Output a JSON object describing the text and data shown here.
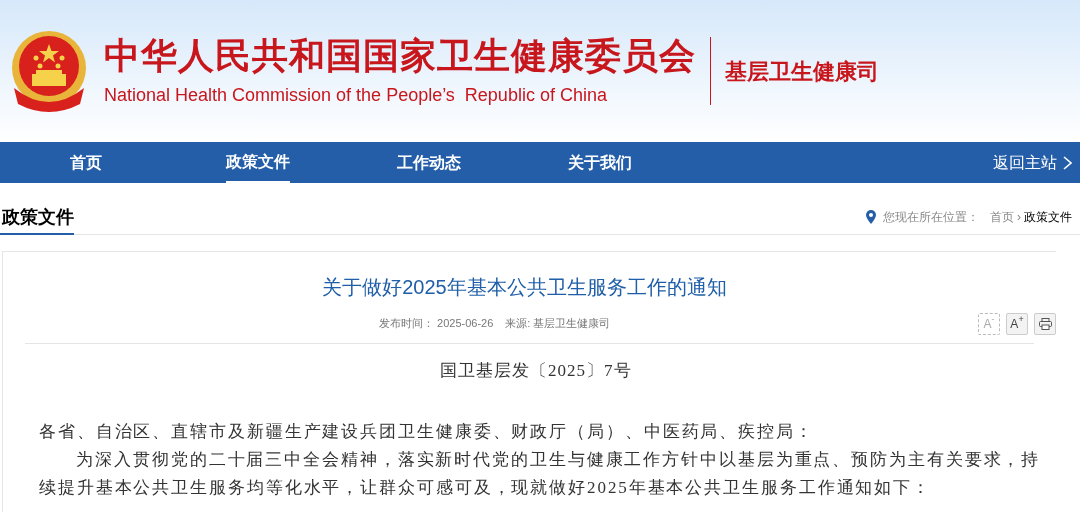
{
  "header": {
    "title": "中华人民共和国国家卫生健康委员会",
    "subtitle": "National Health Commission of the People’s  Republic of China",
    "department": "基层卫生健康司"
  },
  "nav": {
    "items": [
      {
        "label": "首页",
        "selected": false
      },
      {
        "label": "政策文件",
        "selected": true
      },
      {
        "label": "工作动态",
        "selected": false
      },
      {
        "label": "关于我们",
        "selected": false
      }
    ],
    "back_link": "返回主站"
  },
  "section": {
    "title": "政策文件",
    "location_label": "您现在所在位置：",
    "separator": "›",
    "breadcrumb": [
      {
        "label": "首页",
        "current": false
      },
      {
        "label": "政策文件",
        "current": true
      }
    ]
  },
  "article": {
    "title": "关于做好2025年基本公共卫生服务工作的通知",
    "published": "发布时间： 2025-06-26",
    "source": "来源: 基层卫生健康司",
    "tools": [
      {
        "label": "A$^{-}$",
        "kind": "text",
        "disabled": true
      },
      {
        "label": "A$^{+}$",
        "kind": "text",
        "disabled": false
      },
      {
        "kind": "print",
        "disabled": false
      }
    ],
    "doc_number": "国卫基层发〔2025〕7号",
    "paragraphs": [
      {
        "text": "各省、自治区、直辖市及新疆生产建设兵团卫生健康委、财政厅（局）、中医药局、疾控局：",
        "indent": false
      },
      {
        "text": "为深入贯彻党的二十届三中全会精神，落实新时代党的卫生与健康工作方针中以基层为重点、预防为主有关要求，持续提升基本公共卫生服务均等化水平，让群众可感可及，现就做好2025年基本公共卫生服务工作通知如下：",
        "indent": true
      }
    ]
  }
}
